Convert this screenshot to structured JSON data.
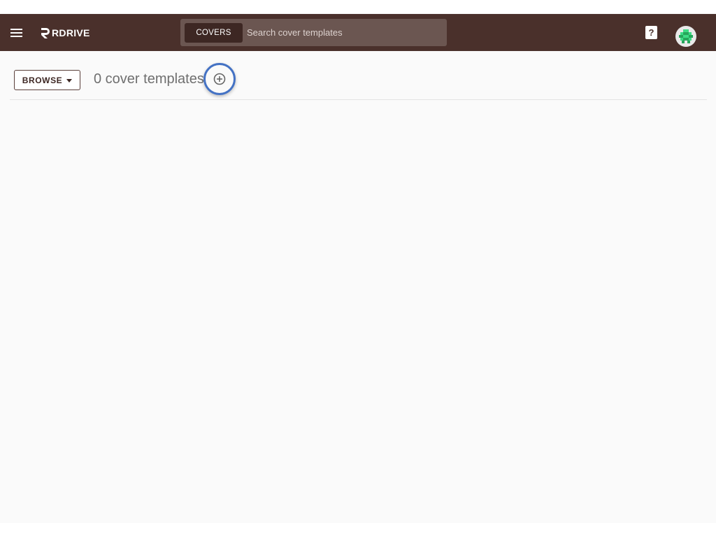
{
  "header": {
    "logo_text": "RDRIVE",
    "search": {
      "scope_label": "COVERS",
      "placeholder": "Search cover templates"
    },
    "help_icon": "help-icon",
    "avatar_icon": "avatar-identicon"
  },
  "toolbar": {
    "browse_label": "BROWSE",
    "count_title": "0 cover templates",
    "add_icon": "add-circle-icon"
  },
  "colors": {
    "appbar": "#4a302b",
    "search_bg": "#6b5651",
    "scope_bg": "#3d2723",
    "focus_ring": "#4472c4",
    "avatar_green": "#3ddc84"
  }
}
